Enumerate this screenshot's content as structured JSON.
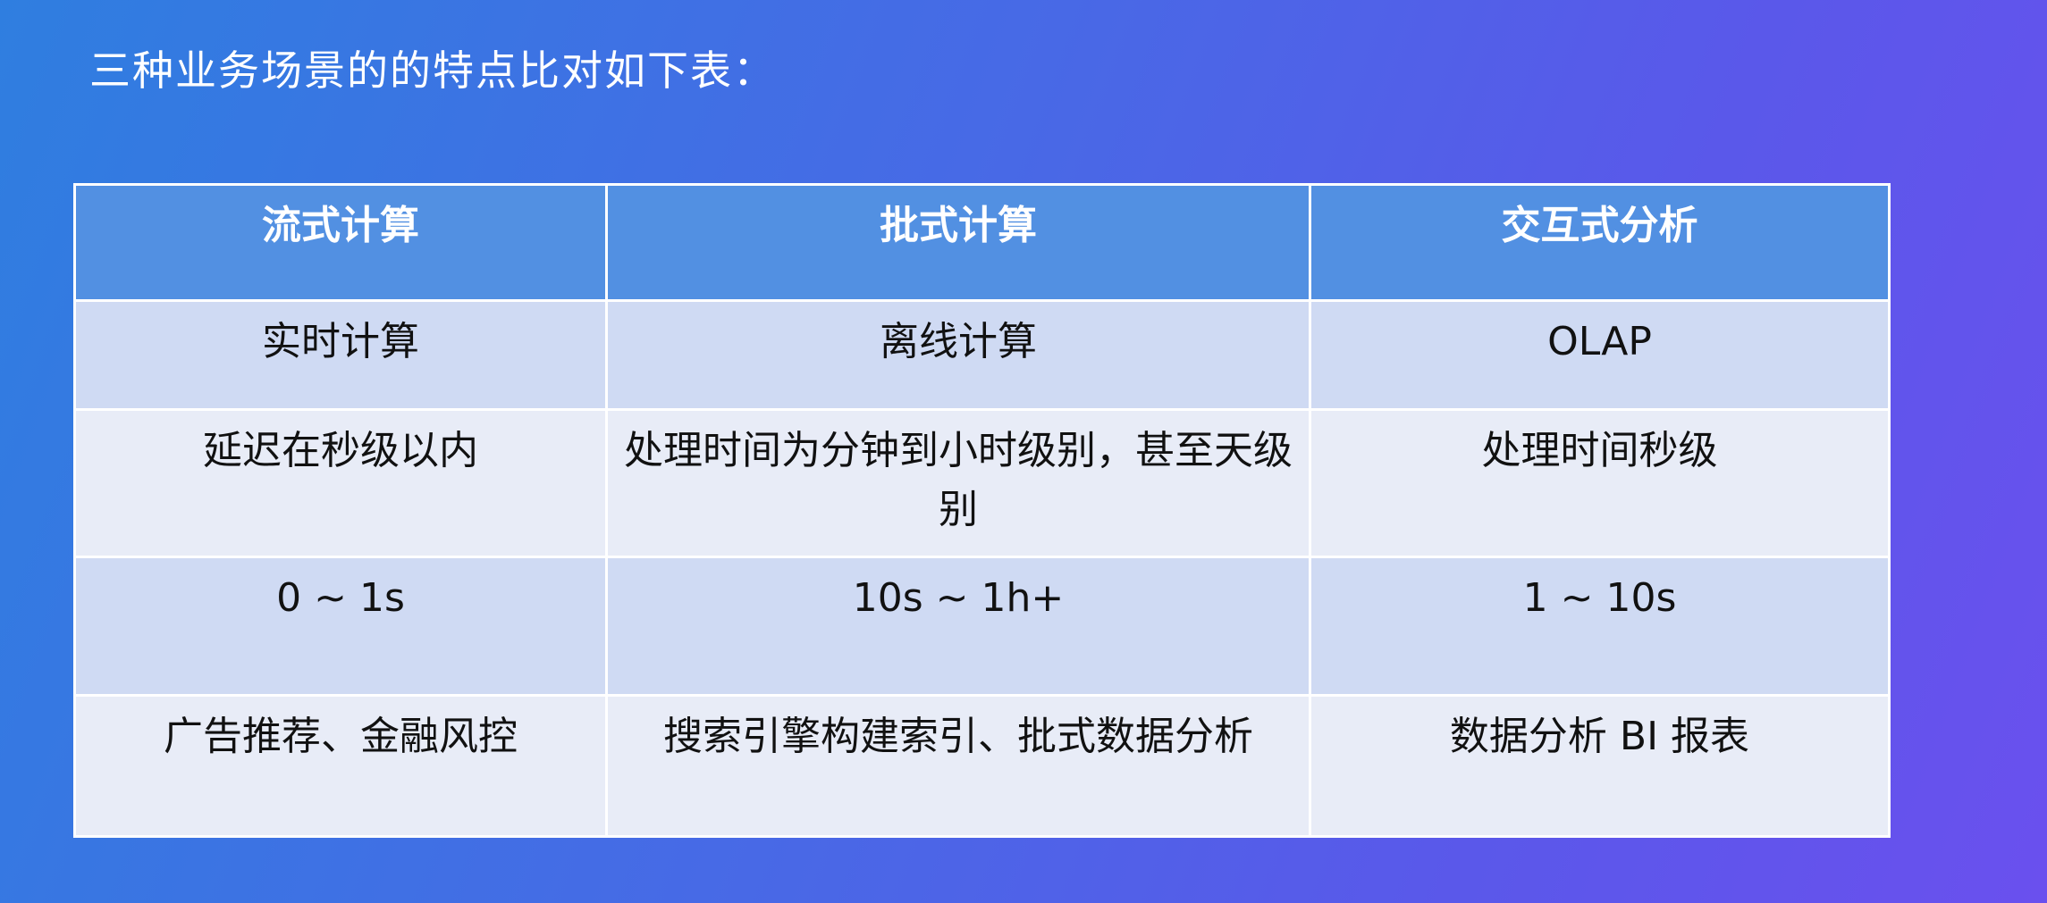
{
  "slide": {
    "title": "三种业务场景的的特点比对如下表："
  },
  "table": {
    "headers": [
      "流式计算",
      "批式计算",
      "交互式分析"
    ],
    "rows": [
      [
        "实时计算",
        "离线计算",
        "OLAP"
      ],
      [
        "延迟在秒级以内",
        "处理时间为分钟到小时级别，甚至天级别",
        "处理时间秒级"
      ],
      [
        "0 ~ 1s",
        "10s ~ 1h+",
        "1 ~ 10s"
      ],
      [
        "广告推荐、金融风控",
        "搜索引擎构建索引、批式数据分析",
        "数据分析 BI 报表"
      ]
    ]
  },
  "colors": {
    "header_bg": "#5290e2",
    "row_alt_bg": "#cfdaf3",
    "row_bg": "#e8ecf7"
  }
}
